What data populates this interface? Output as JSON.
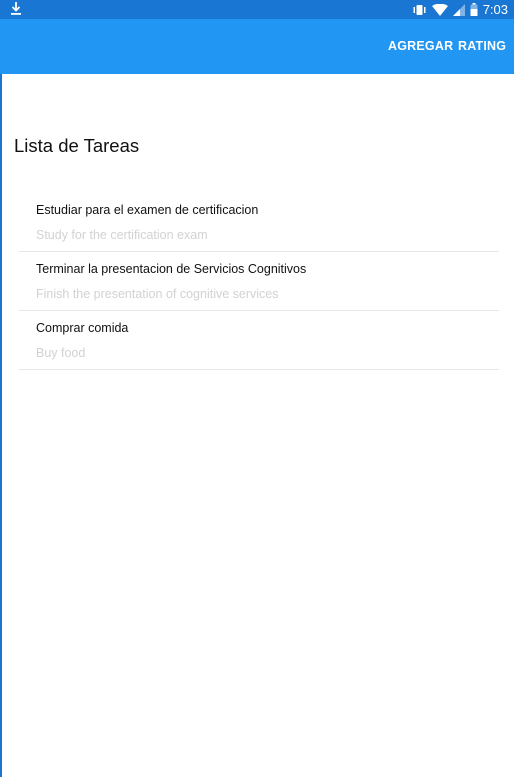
{
  "status_bar": {
    "time": "7:03",
    "icons": [
      "download-icon",
      "vibrate-icon",
      "wifi-icon",
      "signal-icon",
      "battery-icon"
    ]
  },
  "app_bar": {
    "actions": [
      {
        "label": "AGREGAR"
      },
      {
        "label": "RATING"
      }
    ]
  },
  "main": {
    "title": "Lista de Tareas",
    "tasks": [
      {
        "title": "Estudiar para el examen de certificacion",
        "subtitle": "Study for the certification exam"
      },
      {
        "title": "Terminar la presentacion de Servicios Cognitivos",
        "subtitle": "Finish the presentation of cognitive services"
      },
      {
        "title": "Comprar comida",
        "subtitle": "Buy food"
      }
    ]
  },
  "colors": {
    "status_bar": "#1976d2",
    "app_bar": "#2196f3",
    "subtitle_text": "#d2d2d2",
    "divider": "#e6e6e6"
  }
}
